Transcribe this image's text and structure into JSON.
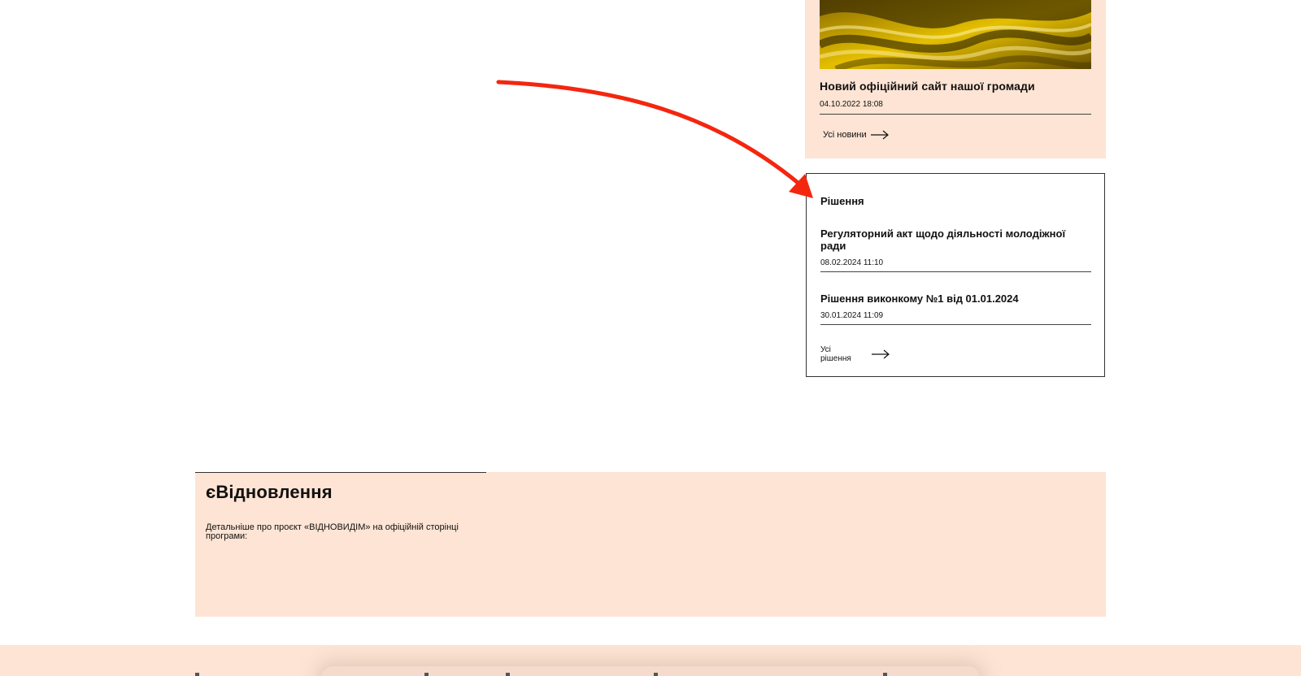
{
  "news": {
    "title": "Новий офіційний сайт нашої громади",
    "date": "04.10.2022 18:08",
    "all_news_label": "Усі новини",
    "image_icon": "golden-silk-image"
  },
  "decisions": {
    "heading": "Рішення",
    "items": [
      {
        "title": "Регуляторний акт щодо діяльності молодіжної ради",
        "date": "08.02.2024 11:10"
      },
      {
        "title": "Рішення виконкому №1 від 01.01.2024",
        "date": "30.01.2024 11:09"
      }
    ],
    "all_label": "Усі рішення"
  },
  "recovery": {
    "title": "єВідновлення",
    "text": "Детальніше про проєкт «ВІДНОВИДІМ» на офіційній сторінці програми:"
  },
  "colors": {
    "peach": "#fde4d4",
    "annotation_red": "#f4260f",
    "gold": "#c9a200"
  },
  "icons": {
    "arrow_right": "arrow-right-icon",
    "annotation": "red-curved-arrow"
  }
}
